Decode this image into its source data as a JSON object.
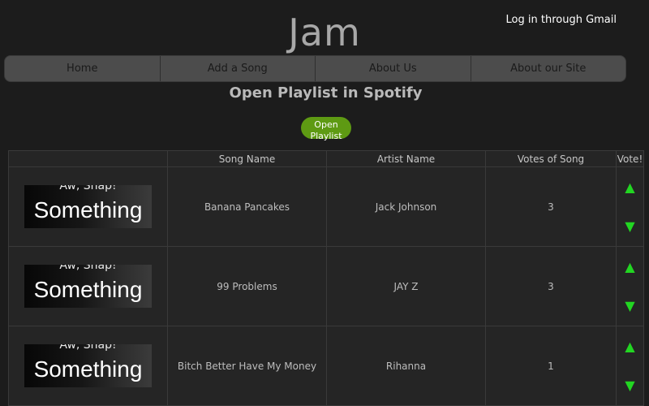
{
  "header": {
    "site_title": "Jam",
    "login_link": "Log in through Gmail"
  },
  "nav": {
    "items": [
      "Home",
      "Add a Song",
      "About Us",
      "About our Site"
    ]
  },
  "playlist": {
    "heading": "Open Playlist in Spotify",
    "open_button": "Open Playlist"
  },
  "table": {
    "columns": [
      "",
      "Song Name",
      "Artist Name",
      "Votes of Song",
      "Vote!"
    ],
    "rows": [
      {
        "thumb_top": "Aw, Snap!",
        "thumb_word": "Something",
        "song": "Banana Pancakes",
        "artist": "Jack Johnson",
        "votes": "3",
        "up": "▲",
        "down": "▼"
      },
      {
        "thumb_top": "Aw, Snap!",
        "thumb_word": "Something",
        "song": "99 Problems",
        "artist": "JAY Z",
        "votes": "3",
        "up": "▲",
        "down": "▼"
      },
      {
        "thumb_top": "Aw, Snap!",
        "thumb_word": "Something",
        "song": "Bitch Better Have My Money",
        "artist": "Rihanna",
        "votes": "1",
        "up": "▲",
        "down": "▼"
      }
    ]
  },
  "colors": {
    "background": "#1c1c1c",
    "nav_bar": "#4c4c4c",
    "open_button": "#5e9a13",
    "vote_arrow": "#22d622"
  },
  "icons": {
    "vote_up": "triangle-up-icon",
    "vote_down": "triangle-down-icon"
  }
}
